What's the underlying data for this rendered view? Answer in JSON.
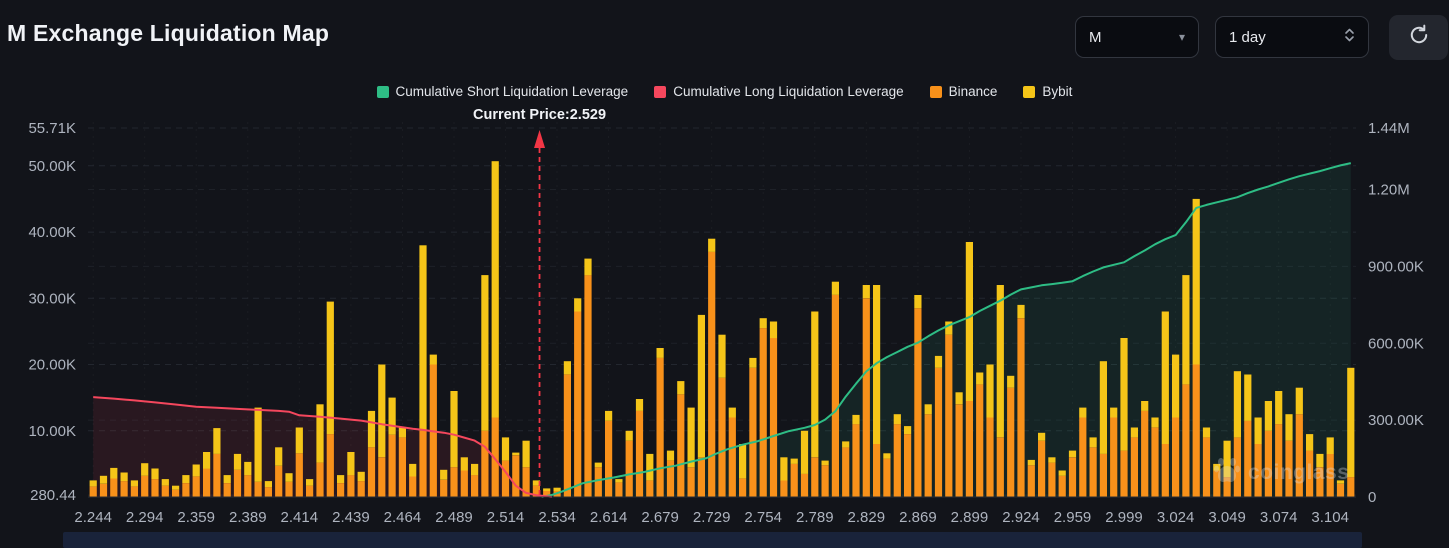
{
  "header": {
    "title": "M Exchange Liquidation Map",
    "symbol_select": {
      "value": "M"
    },
    "interval_select": {
      "value": "1 day"
    }
  },
  "legend": [
    {
      "label": "Cumulative Short Liquidation Leverage",
      "color": "#2EBD85"
    },
    {
      "label": "Cumulative Long Liquidation Leverage",
      "color": "#F5475D"
    },
    {
      "label": "Binance",
      "color": "#F8911A"
    },
    {
      "label": "Bybit",
      "color": "#F5C518"
    }
  ],
  "watermark": "coinglass",
  "chart_data": {
    "type": "bar",
    "title": "M Exchange Liquidation Map",
    "current_price": 2.529,
    "current_price_label": "Current Price:2.529",
    "current_price_color": "#F23645",
    "marker_bar_index": 43.3,
    "grid": true,
    "background": "#12141a",
    "x_tick_labels": [
      "2.244",
      "2.294",
      "2.359",
      "2.389",
      "2.414",
      "2.439",
      "2.464",
      "2.489",
      "2.514",
      "2.534",
      "2.614",
      "2.679",
      "2.729",
      "2.754",
      "2.789",
      "2.829",
      "2.869",
      "2.899",
      "2.924",
      "2.959",
      "2.999",
      "3.024",
      "3.049",
      "3.074",
      "3.104"
    ],
    "bars_per_tick": 5,
    "left_axis": {
      "unit": "liquidation leverage",
      "ticks": [
        {
          "label": "55.71K",
          "value": 55710
        },
        {
          "label": "50.00K",
          "value": 50000
        },
        {
          "label": "40.00K",
          "value": 40000
        },
        {
          "label": "30.00K",
          "value": 30000
        },
        {
          "label": "20.00K",
          "value": 20000
        },
        {
          "label": "10.00K",
          "value": 10000
        },
        {
          "label": "280.44",
          "value": 280.44
        }
      ],
      "top_value": 55710
    },
    "right_axis": {
      "unit": "cumulative leverage",
      "ticks": [
        {
          "label": "1.44M",
          "value_k": 1440
        },
        {
          "label": "1.20M",
          "value_k": 1200
        },
        {
          "label": "900.00K",
          "value_k": 900
        },
        {
          "label": "600.00K",
          "value_k": 600
        },
        {
          "label": "300.00K",
          "value_k": 300
        },
        {
          "label": "0",
          "value_k": 0
        }
      ],
      "top_value_k": 1440
    },
    "bar_series_names": [
      "Binance",
      "Bybit"
    ],
    "bar_colors": {
      "binance": "#F8911A",
      "bybit": "#F5C518"
    },
    "bars_k_binance_bybit": [
      [
        1.6,
        0.9
      ],
      [
        2.0,
        1.2
      ],
      [
        2.8,
        1.6
      ],
      [
        2.4,
        1.3
      ],
      [
        1.6,
        0.9
      ],
      [
        3.2,
        1.9
      ],
      [
        2.7,
        1.6
      ],
      [
        1.7,
        1.0
      ],
      [
        1.1,
        0.6
      ],
      [
        2.1,
        1.2
      ],
      [
        3.1,
        1.8
      ],
      [
        4.3,
        2.5
      ],
      [
        6.5,
        3.9
      ],
      [
        2.1,
        1.2
      ],
      [
        4.1,
        2.4
      ],
      [
        3.3,
        2.0
      ],
      [
        2.3,
        11.2
      ],
      [
        1.5,
        0.9
      ],
      [
        4.7,
        2.8
      ],
      [
        2.3,
        1.3
      ],
      [
        6.6,
        3.9
      ],
      [
        1.7,
        1.0
      ],
      [
        5.2,
        8.8
      ],
      [
        9.5,
        20.0
      ],
      [
        2.1,
        1.2
      ],
      [
        3.3,
        3.5
      ],
      [
        2.4,
        1.4
      ],
      [
        7.5,
        5.5
      ],
      [
        6.0,
        14.0
      ],
      [
        9.4,
        5.6
      ],
      [
        9.0,
        1.5
      ],
      [
        3.1,
        1.9
      ],
      [
        10.0,
        28.0
      ],
      [
        20.0,
        1.5
      ],
      [
        2.6,
        1.5
      ],
      [
        4.5,
        11.5
      ],
      [
        4.0,
        2.0
      ],
      [
        3.3,
        1.7
      ],
      [
        10.0,
        23.5
      ],
      [
        12.0,
        38.7
      ],
      [
        5.5,
        3.5
      ],
      [
        6.3,
        0.4
      ],
      [
        4.5,
        4.0
      ],
      [
        1.7,
        0.8
      ],
      [
        0.9,
        0.4
      ],
      [
        0.9,
        0.5
      ],
      [
        18.5,
        2.0
      ],
      [
        28.0,
        2.0
      ],
      [
        33.5,
        2.5
      ],
      [
        4.5,
        0.7
      ],
      [
        11.5,
        1.5
      ],
      [
        2.2,
        0.5
      ],
      [
        8.5,
        1.5
      ],
      [
        13.0,
        1.8
      ],
      [
        2.5,
        4.0
      ],
      [
        21.0,
        1.5
      ],
      [
        5.5,
        1.5
      ],
      [
        15.5,
        2.0
      ],
      [
        4.5,
        9.0
      ],
      [
        6.0,
        21.5
      ],
      [
        37.0,
        2.0
      ],
      [
        18.0,
        6.5
      ],
      [
        12.0,
        1.5
      ],
      [
        2.8,
        5.2
      ],
      [
        19.5,
        1.5
      ],
      [
        25.5,
        1.5
      ],
      [
        24.0,
        2.5
      ],
      [
        2.5,
        3.5
      ],
      [
        5.0,
        0.8
      ],
      [
        3.5,
        6.5
      ],
      [
        6.0,
        22.0
      ],
      [
        4.8,
        0.7
      ],
      [
        30.5,
        2.0
      ],
      [
        7.5,
        0.9
      ],
      [
        11.0,
        1.4
      ],
      [
        30.0,
        2.0
      ],
      [
        8.0,
        24.0
      ],
      [
        5.8,
        0.8
      ],
      [
        11.0,
        1.5
      ],
      [
        9.5,
        1.2
      ],
      [
        28.5,
        2.0
      ],
      [
        12.5,
        1.5
      ],
      [
        19.5,
        1.8
      ],
      [
        24.5,
        2.0
      ],
      [
        14.0,
        1.8
      ],
      [
        14.5,
        24.0
      ],
      [
        17.0,
        1.8
      ],
      [
        12.0,
        8.0
      ],
      [
        9.0,
        23.0
      ],
      [
        16.5,
        1.8
      ],
      [
        27.0,
        2.0
      ],
      [
        4.8,
        0.8
      ],
      [
        8.5,
        1.2
      ],
      [
        5.2,
        0.8
      ],
      [
        3.2,
        0.8
      ],
      [
        6.0,
        1.0
      ],
      [
        12.0,
        1.5
      ],
      [
        7.5,
        1.5
      ],
      [
        6.5,
        14.0
      ],
      [
        12.0,
        1.5
      ],
      [
        7.0,
        17.0
      ],
      [
        9.0,
        1.5
      ],
      [
        13.0,
        1.5
      ],
      [
        10.5,
        1.5
      ],
      [
        8.0,
        20.0
      ],
      [
        12.0,
        9.5
      ],
      [
        17.0,
        16.5
      ],
      [
        20.0,
        25.0
      ],
      [
        9.0,
        1.5
      ],
      [
        4.0,
        1.0
      ],
      [
        3.0,
        5.5
      ],
      [
        9.0,
        10.0
      ],
      [
        11.5,
        7.0
      ],
      [
        8.0,
        4.0
      ],
      [
        10.0,
        4.5
      ],
      [
        11.0,
        5.0
      ],
      [
        8.5,
        4.0
      ],
      [
        12.5,
        4.0
      ],
      [
        7.0,
        2.5
      ],
      [
        4.5,
        2.0
      ],
      [
        6.5,
        2.5
      ],
      [
        2.0,
        0.5
      ],
      [
        3.0,
        16.5
      ]
    ],
    "series": [
      {
        "name": "Cumulative Short Liquidation Leverage",
        "color": "#2EBD85",
        "axis": "right",
        "points_idx_k": [
          [
            43.5,
            0
          ],
          [
            44.5,
            8
          ],
          [
            45.5,
            22
          ],
          [
            46.5,
            38
          ],
          [
            47.5,
            54
          ],
          [
            49,
            66
          ],
          [
            50.5,
            76
          ],
          [
            52,
            88
          ],
          [
            53.5,
            98
          ],
          [
            55,
            112
          ],
          [
            56.5,
            122
          ],
          [
            58,
            138
          ],
          [
            59.5,
            152
          ],
          [
            60.5,
            170
          ],
          [
            61.5,
            186
          ],
          [
            63,
            204
          ],
          [
            64.5,
            218
          ],
          [
            66,
            238
          ],
          [
            67.5,
            257
          ],
          [
            69,
            270
          ],
          [
            70,
            281
          ],
          [
            71,
            302
          ],
          [
            72,
            335
          ],
          [
            73,
            392
          ],
          [
            74,
            442
          ],
          [
            75,
            490
          ],
          [
            76,
            522
          ],
          [
            77,
            546
          ],
          [
            78,
            566
          ],
          [
            79,
            586
          ],
          [
            80,
            602
          ],
          [
            81,
            627
          ],
          [
            82,
            650
          ],
          [
            83,
            670
          ],
          [
            84,
            686
          ],
          [
            85,
            702
          ],
          [
            86,
            726
          ],
          [
            87,
            746
          ],
          [
            88,
            766
          ],
          [
            89,
            790
          ],
          [
            90,
            810
          ],
          [
            91,
            818
          ],
          [
            92,
            826
          ],
          [
            93,
            831
          ],
          [
            94,
            836
          ],
          [
            95,
            842
          ],
          [
            96,
            862
          ],
          [
            97,
            880
          ],
          [
            98,
            896
          ],
          [
            99,
            906
          ],
          [
            100,
            916
          ],
          [
            101,
            940
          ],
          [
            102,
            962
          ],
          [
            103,
            986
          ],
          [
            104,
            1006
          ],
          [
            105,
            1022
          ],
          [
            106,
            1072
          ],
          [
            107,
            1128
          ],
          [
            108,
            1140
          ],
          [
            109,
            1150
          ],
          [
            110,
            1160
          ],
          [
            111,
            1170
          ],
          [
            112,
            1186
          ],
          [
            113,
            1200
          ],
          [
            114,
            1212
          ],
          [
            115,
            1226
          ],
          [
            116,
            1240
          ],
          [
            117,
            1252
          ],
          [
            118,
            1262
          ],
          [
            119,
            1272
          ],
          [
            120,
            1283
          ],
          [
            121,
            1294
          ],
          [
            122,
            1303
          ]
        ]
      },
      {
        "name": "Cumulative Long Liquidation Leverage",
        "color": "#F5475D",
        "axis": "right",
        "points_idx_k": [
          [
            0,
            390
          ],
          [
            2,
            384
          ],
          [
            4,
            377
          ],
          [
            6,
            369
          ],
          [
            8,
            361
          ],
          [
            10,
            352
          ],
          [
            12,
            348
          ],
          [
            14,
            344
          ],
          [
            16,
            340
          ],
          [
            18,
            336
          ],
          [
            19,
            333
          ],
          [
            20,
            319
          ],
          [
            21,
            316
          ],
          [
            22,
            313
          ],
          [
            24,
            306
          ],
          [
            26,
            298
          ],
          [
            27,
            291
          ],
          [
            28,
            284
          ],
          [
            30,
            272
          ],
          [
            31,
            266
          ],
          [
            32,
            262
          ],
          [
            33,
            256
          ],
          [
            34,
            251
          ],
          [
            35,
            243
          ],
          [
            36,
            232
          ],
          [
            37,
            220
          ],
          [
            38,
            196
          ],
          [
            39,
            148
          ],
          [
            40,
            98
          ],
          [
            41,
            44
          ],
          [
            42,
            16
          ],
          [
            43,
            7
          ],
          [
            44,
            3
          ],
          [
            44.5,
            0
          ]
        ]
      }
    ]
  }
}
